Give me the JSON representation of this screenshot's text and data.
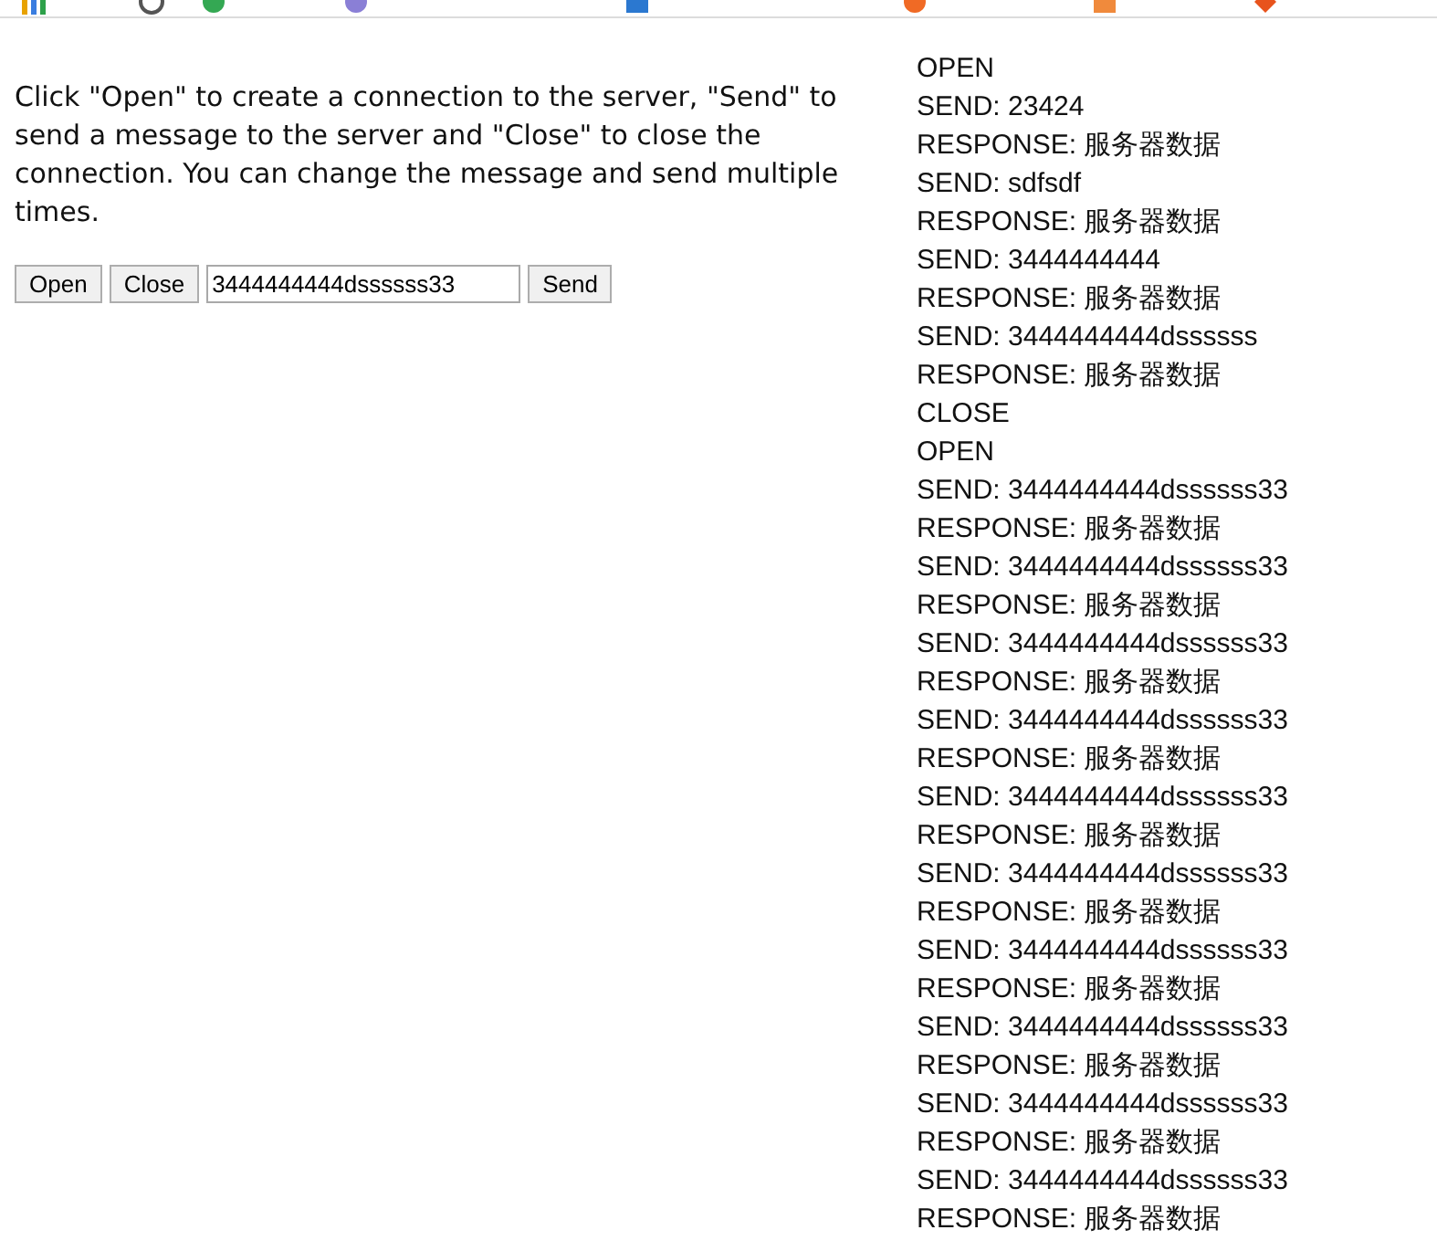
{
  "instructions": "Click \"Open\" to create a connection to the server, \"Send\" to send a message to the server and \"Close\" to close the connection. You can change the message and send multiple times.",
  "controls": {
    "open_button": "Open",
    "close_button": "Close",
    "message": "3444444444dssssss33",
    "send_button": "Send"
  },
  "log": [
    "OPEN",
    "SEND: 23424",
    "RESPONSE: 服务器数据",
    "SEND: sdfsdf",
    "RESPONSE: 服务器数据",
    "SEND: 3444444444",
    "RESPONSE: 服务器数据",
    "SEND: 3444444444dssssss",
    "RESPONSE: 服务器数据",
    "CLOSE",
    "OPEN",
    "SEND: 3444444444dssssss33",
    "RESPONSE: 服务器数据",
    "SEND: 3444444444dssssss33",
    "RESPONSE: 服务器数据",
    "SEND: 3444444444dssssss33",
    "RESPONSE: 服务器数据",
    "SEND: 3444444444dssssss33",
    "RESPONSE: 服务器数据",
    "SEND: 3444444444dssssss33",
    "RESPONSE: 服务器数据",
    "SEND: 3444444444dssssss33",
    "RESPONSE: 服务器数据",
    "SEND: 3444444444dssssss33",
    "RESPONSE: 服务器数据",
    "SEND: 3444444444dssssss33",
    "RESPONSE: 服务器数据",
    "SEND: 3444444444dssssss33",
    "RESPONSE: 服务器数据",
    "SEND: 3444444444dssssss33",
    "RESPONSE: 服务器数据"
  ]
}
